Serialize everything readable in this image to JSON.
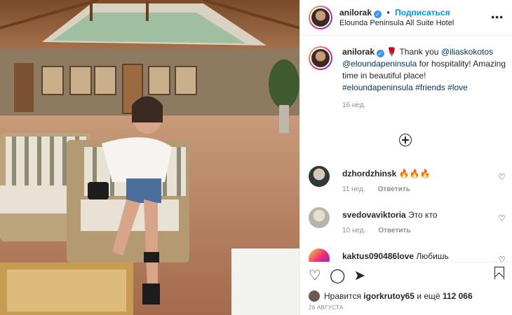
{
  "post": {
    "username": "anilorak",
    "follow_label": "Подписаться",
    "separator": "•",
    "location": "Elounda Peninsula All Suite Hotel",
    "more_icon": "more-horizontal-icon"
  },
  "caption": {
    "username": "anilorak",
    "emoji": "🌹",
    "text_before": " Thank you",
    "mention1": "@iliaskokotos",
    "mention2": "@eloundapeninsula",
    "text_after": " for hospitality! Amazing time in beautiful place!",
    "hashtag1": "#eloundapeninsula",
    "hashtag2": "#friends",
    "hashtag3": "#love",
    "time": "16 нед."
  },
  "comments": [
    {
      "username": "dzhordzhinsk",
      "text": "🔥🔥🔥",
      "time": "11 нед.",
      "reply": "Ответить"
    },
    {
      "username": "svedovaviktoria",
      "text": "Это кто",
      "time": "10 нед.",
      "reply": "Ответить"
    },
    {
      "username": "kaktus090486love",
      "text": "Любишь",
      "time": "",
      "reply": ""
    }
  ],
  "likes": {
    "prefix": "Нравится",
    "user": "igorkrutoy65",
    "middle": "и ещё",
    "count": "112 066"
  },
  "date": "26 АВГУСТА",
  "colors": {
    "link": "#00376b",
    "follow": "#0095f6",
    "verified": "#3897f0"
  }
}
